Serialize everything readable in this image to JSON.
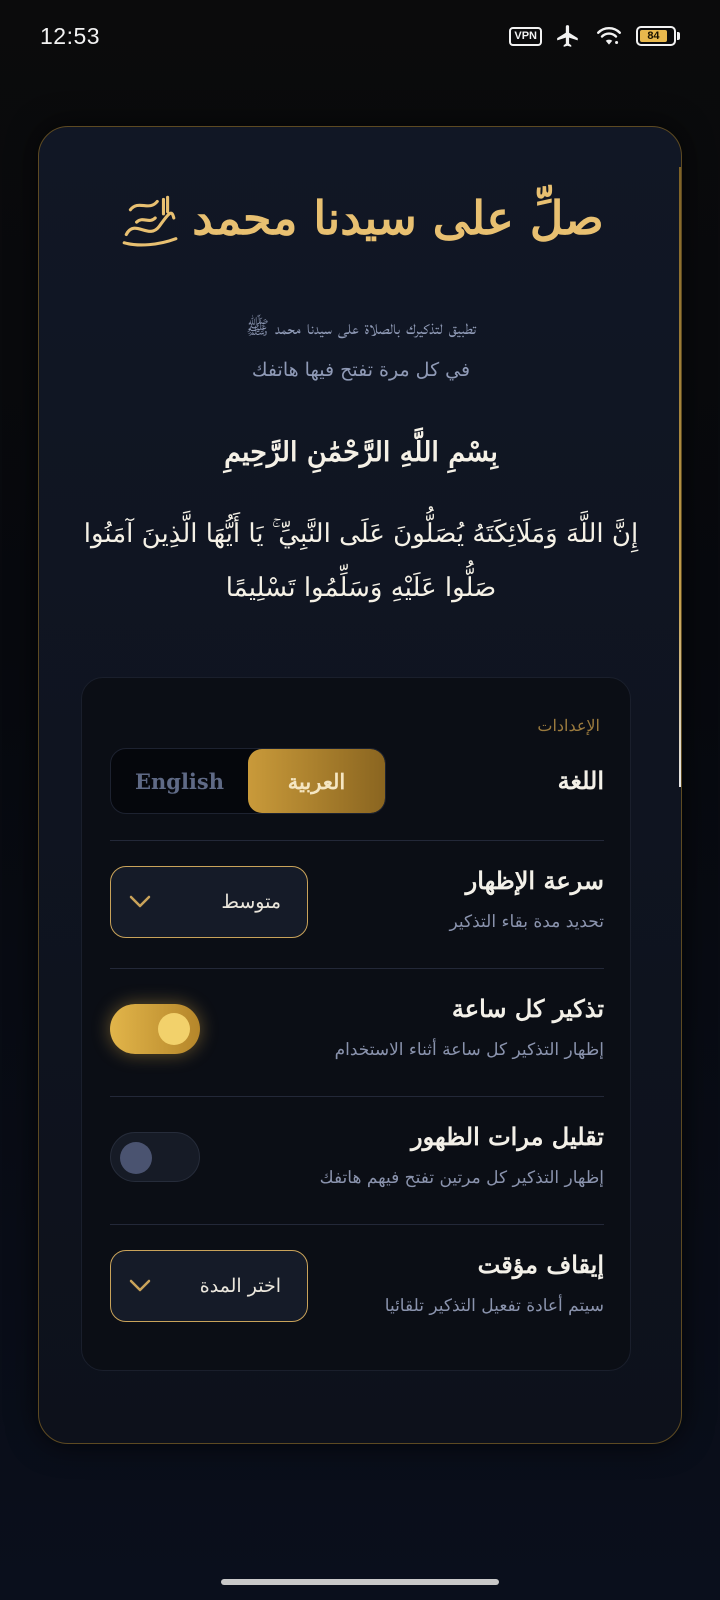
{
  "status_bar": {
    "time": "12:53",
    "vpn": "VPN",
    "battery": "84",
    "icons": [
      "vpn-icon",
      "airplane-icon",
      "wifi-icon",
      "battery-icon"
    ]
  },
  "hero": {
    "title": "صلِّ على سيدنا محمد",
    "subtitle_line1": "تطبيق لتذكيرك بالصلاة على سيدنا محمد ﷺ",
    "subtitle_line2": "في كل مرة تفتح فيها هاتفك",
    "bismillah": "بِسْمِ اللَّهِ الرَّحْمَٰنِ الرَّحِيمِ",
    "ayah": "إِنَّ اللَّهَ وَمَلَائِكَتَهُ يُصَلُّونَ عَلَى النَّبِيِّ ۚ يَا أَيُّهَا الَّذِينَ آمَنُوا صَلُّوا عَلَيْهِ وَسَلِّمُوا تَسْلِيمًا"
  },
  "settings": {
    "heading": "الإعدادات",
    "language": {
      "title": "اللغة",
      "options": [
        "English",
        "العربية"
      ],
      "selected": "العربية"
    },
    "display_speed": {
      "title": "سرعة الإظهار",
      "description": "تحديد مدة بقاء التذكير",
      "value": "متوسط"
    },
    "hourly_reminder": {
      "title": "تذكير كل ساعة",
      "description": "إظهار التذكير كل ساعة أثناء الاستخدام",
      "enabled": true
    },
    "reduce_frequency": {
      "title": "تقليل مرات الظهور",
      "description": "إظهار التذكير كل مرتين تفتح فيهم هاتفك",
      "enabled": false
    },
    "pause": {
      "title": "إيقاف مؤقت",
      "description": "سيتم أعادة تفعيل التذكير تلقائيا",
      "value": "اختر المدة"
    }
  },
  "colors": {
    "accent_gold": "#e8c071",
    "card_bg": "#111725",
    "panel_bg": "#0b0e15"
  }
}
